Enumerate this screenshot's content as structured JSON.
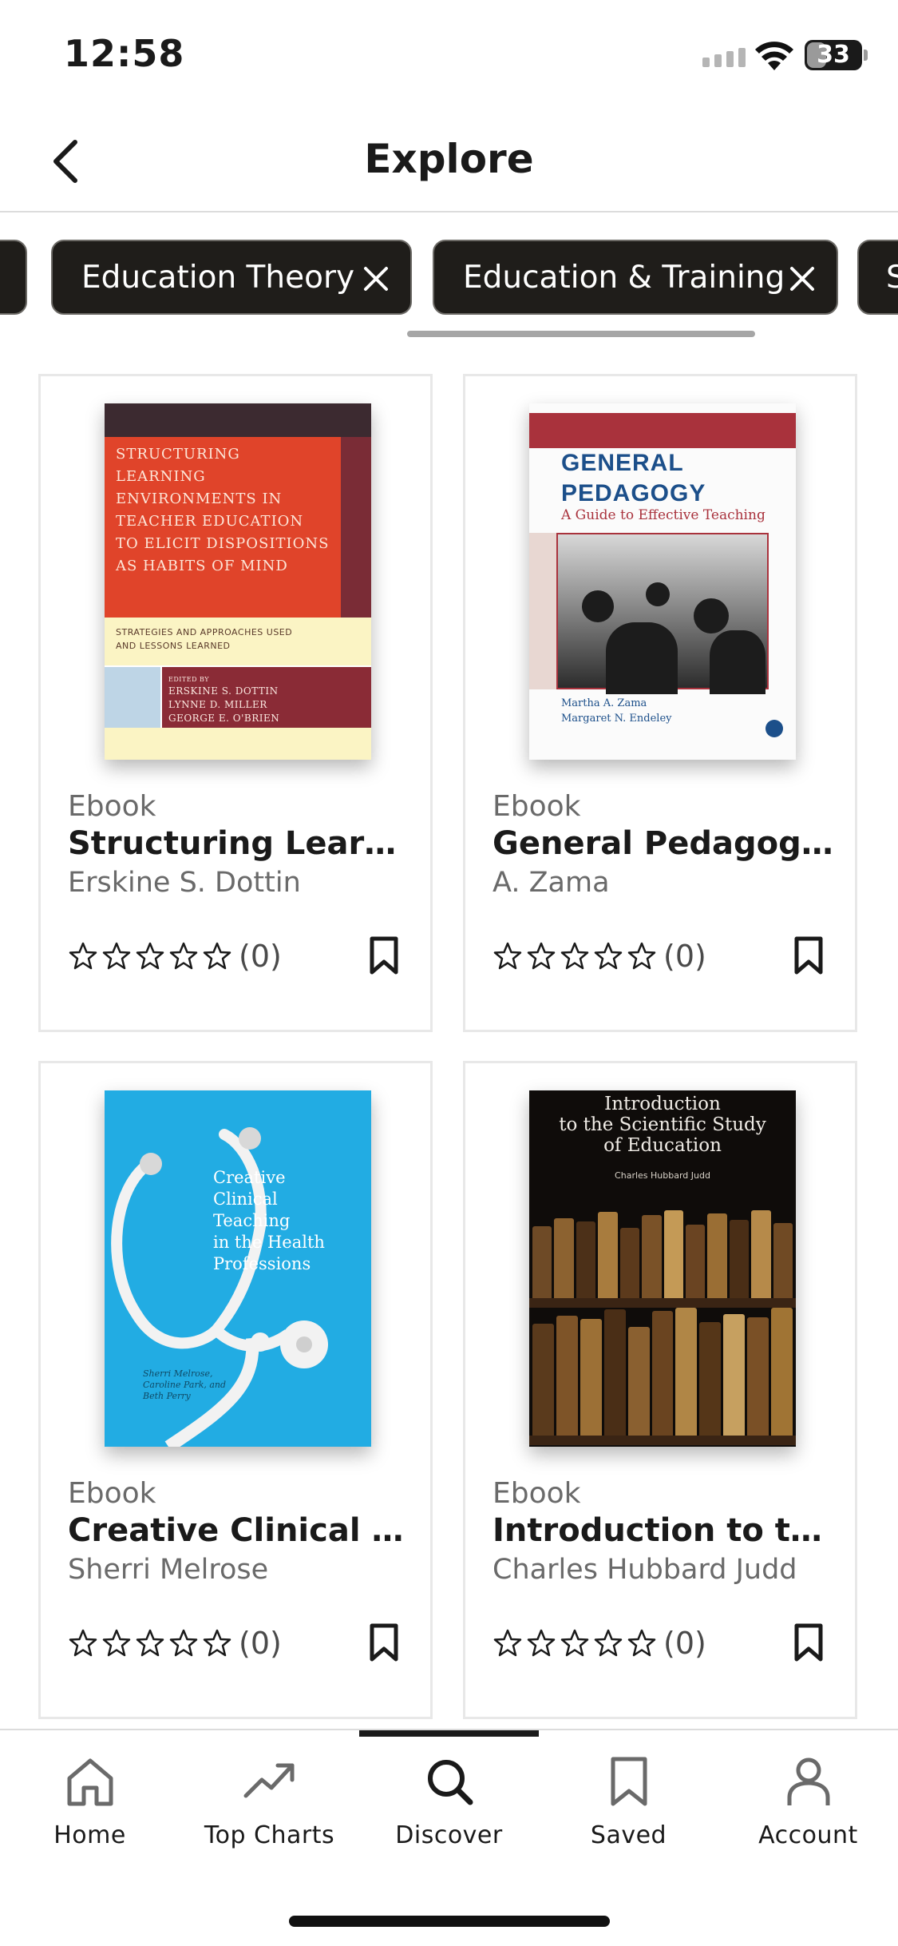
{
  "status_bar": {
    "time": "12:58",
    "battery_level": "33",
    "icons": [
      "signal-icon",
      "wifi-icon",
      "battery-icon"
    ]
  },
  "header": {
    "back_icon": "chevron-left-icon",
    "title": "Explore"
  },
  "chips": [
    {
      "label": "Education Theory",
      "icon": "close-icon"
    },
    {
      "label": "Education & Training",
      "icon": "close-icon"
    },
    {
      "label": "S"
    }
  ],
  "books": [
    {
      "type": "Ebook",
      "title": "Structuring Learning…",
      "author": "Erskine S. Dottin",
      "rating_count": "(0)",
      "cover": {
        "title_lines": [
          "STRUCTURING",
          "LEARNING",
          "ENVIRONMENTS IN",
          "TEACHER EDUCATION",
          "TO ELICIT DISPOSITIONS",
          "AS HABITS OF MIND"
        ],
        "subtitle_lines": [
          "STRATEGIES AND APPROACHES USED",
          "AND LESSONS LEARNED"
        ],
        "editors_label": "EDITED BY",
        "editors": [
          "ERSKINE S. DOTTIN",
          "LYNNE D. MILLER",
          "GEORGE E. O'BRIEN"
        ]
      }
    },
    {
      "type": "Ebook",
      "title": "General Pedagogy: A…",
      "author": "A. Zama",
      "rating_count": "(0)",
      "cover": {
        "title_lines": [
          "GENERAL",
          "PEDAGOGY"
        ],
        "subtitle": "A Guide to Effective Teaching",
        "authors": [
          "Martha A. Zama",
          "Margaret N. Endeley"
        ]
      }
    },
    {
      "type": "Ebook",
      "title": "Creative Clinical Tea…",
      "author": "Sherri Melrose",
      "rating_count": "(0)",
      "cover": {
        "title_lines": [
          "Creative",
          "Clinical",
          "Teaching",
          "in the Health",
          "Professions"
        ],
        "authors": [
          "Sherri Melrose,",
          "Caroline Park, and",
          "Beth Perry"
        ]
      }
    },
    {
      "type": "Ebook",
      "title": "Introduction to the s…",
      "author": "Charles Hubbard Judd",
      "rating_count": "(0)",
      "cover": {
        "title_lines": [
          "Introduction",
          "to the Scientific Study",
          "of Education"
        ],
        "author": "Charles Hubbard Judd"
      }
    }
  ],
  "tab_bar": {
    "active": "Discover",
    "tabs": [
      {
        "label": "Home",
        "icon": "home-icon"
      },
      {
        "label": "Top Charts",
        "icon": "trending-up-icon"
      },
      {
        "label": "Discover",
        "icon": "search-icon"
      },
      {
        "label": "Saved",
        "icon": "bookmark-icon"
      },
      {
        "label": "Account",
        "icon": "person-icon"
      }
    ]
  },
  "colors": {
    "chip_bg": "#1f1d1a",
    "text_primary": "#1a1a1a",
    "text_secondary": "#6a6a6a",
    "divider": "#dcdcdc"
  }
}
